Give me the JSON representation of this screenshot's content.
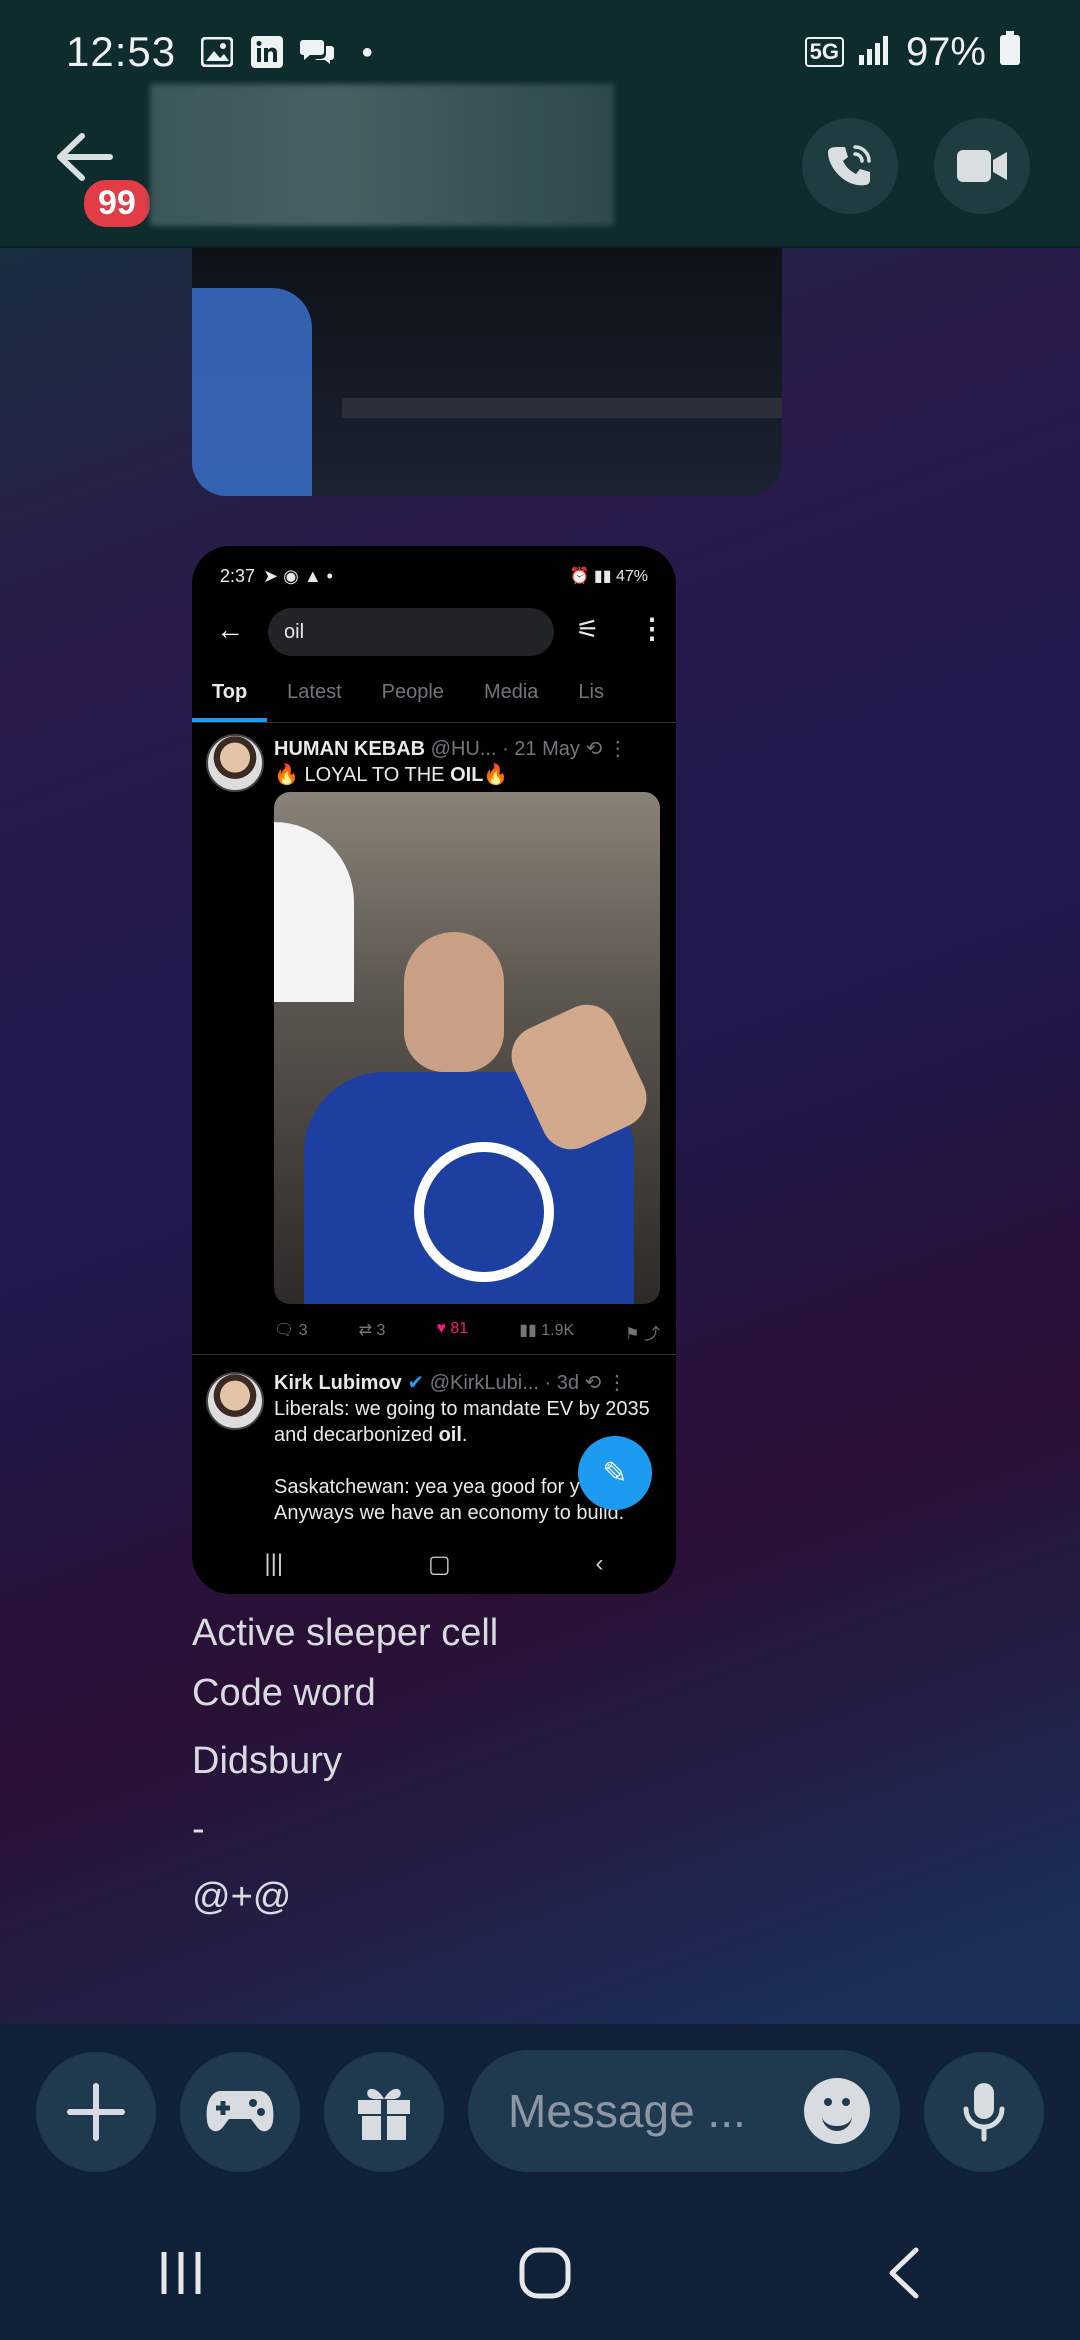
{
  "status_bar": {
    "time": "12:53",
    "network": "5G",
    "battery": "97%"
  },
  "header": {
    "unread_badge": "99",
    "title_blurred": true
  },
  "shared_screenshot": {
    "status": {
      "time": "2:37",
      "battery": "47%"
    },
    "search_query": "oil",
    "tabs": [
      "Top",
      "Latest",
      "People",
      "Media",
      "Lis"
    ],
    "active_tab": "Top",
    "tweet1": {
      "name": "HUMAN KEBAB",
      "handle": "@HU...",
      "date": "· 21 May",
      "text_before": "🔥 LOYAL TO THE ",
      "text_bold": "OIL",
      "text_after": "🔥",
      "replies": "3",
      "retweets": "3",
      "likes": "81",
      "views": "1.9K"
    },
    "tweet2": {
      "name": "Kirk Lubimov",
      "handle": "@KirkLubi...",
      "date": "· 3d",
      "line1": "Liberals: we going to mandate EV by 2035",
      "line2_before": "and decarbonized ",
      "line2_bold": "oil",
      "line2_after": ".",
      "line3": "Saskatchewan: yea yea good for y",
      "line4": "Anyways we have an economy to build."
    }
  },
  "messages": [
    "Active sleeper cell",
    "Code word",
    "Didsbury",
    "-",
    "@+@"
  ],
  "composer": {
    "placeholder": "Message ..."
  },
  "colors": {
    "badge": "#e23c47",
    "accent_blue": "#1d9bf0",
    "like_pink": "#f91880"
  }
}
